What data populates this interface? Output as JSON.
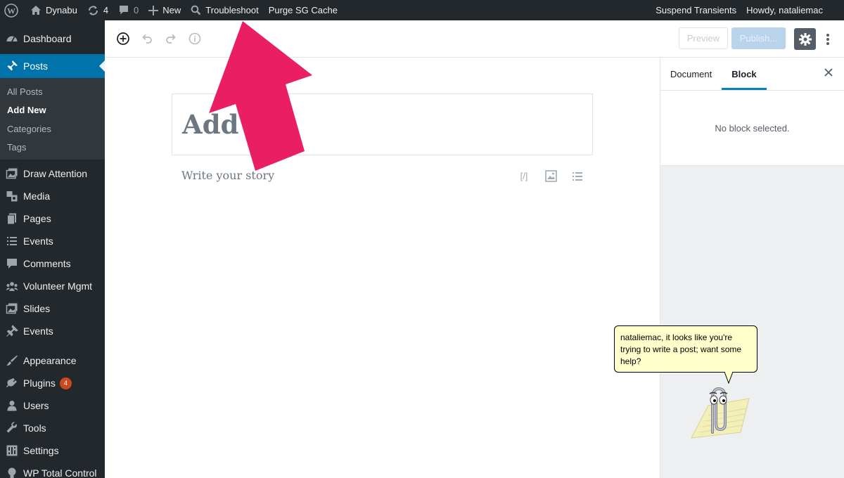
{
  "adminbar": {
    "site_name": "Dynabu",
    "updates_count": "4",
    "comments_count": "0",
    "new_label": "New",
    "troubleshoot_label": "Troubleshoot",
    "purge_label": "Purge SG Cache",
    "suspend_label": "Suspend Transients",
    "howdy_label": "Howdy, nataliemac"
  },
  "sidebar": {
    "dashboard": "Dashboard",
    "posts": "Posts",
    "posts_sub": [
      "All Posts",
      "Add New",
      "Categories",
      "Tags"
    ],
    "items": [
      {
        "label": "Draw Attention",
        "icon": "images-icon"
      },
      {
        "label": "Media",
        "icon": "media-icon"
      },
      {
        "label": "Pages",
        "icon": "pages-icon"
      },
      {
        "label": "Events",
        "icon": "list-icon"
      },
      {
        "label": "Comments",
        "icon": "comment-icon"
      },
      {
        "label": "Volunteer Mgmt",
        "icon": "groups-icon"
      },
      {
        "label": "Slides",
        "icon": "slides-icon"
      },
      {
        "label": "Events",
        "icon": "pin-icon"
      }
    ],
    "items2": [
      {
        "label": "Appearance",
        "icon": "brush-icon"
      },
      {
        "label": "Plugins",
        "icon": "plug-icon",
        "badge": "4"
      },
      {
        "label": "Users",
        "icon": "user-icon"
      },
      {
        "label": "Tools",
        "icon": "wrench-icon"
      },
      {
        "label": "Settings",
        "icon": "settings-icon"
      },
      {
        "label": "WP Total Control",
        "icon": "bulb-icon"
      }
    ]
  },
  "header": {
    "preview_label": "Preview",
    "publish_label": "Publish..."
  },
  "editor": {
    "title_text": "Add t",
    "story_placeholder": "Write your story",
    "shortcode_glyph": "[/]"
  },
  "settings_panel": {
    "tab_document": "Document",
    "tab_block": "Block",
    "no_block": "No block selected."
  },
  "clippy": {
    "message": "nataliemac, it looks like you're trying to write a post; want some help?"
  },
  "colors": {
    "adminbar_bg": "#23282d",
    "accent": "#0073aa",
    "arrow": "#e91e63",
    "bubble_bg": "#ffffcc"
  }
}
